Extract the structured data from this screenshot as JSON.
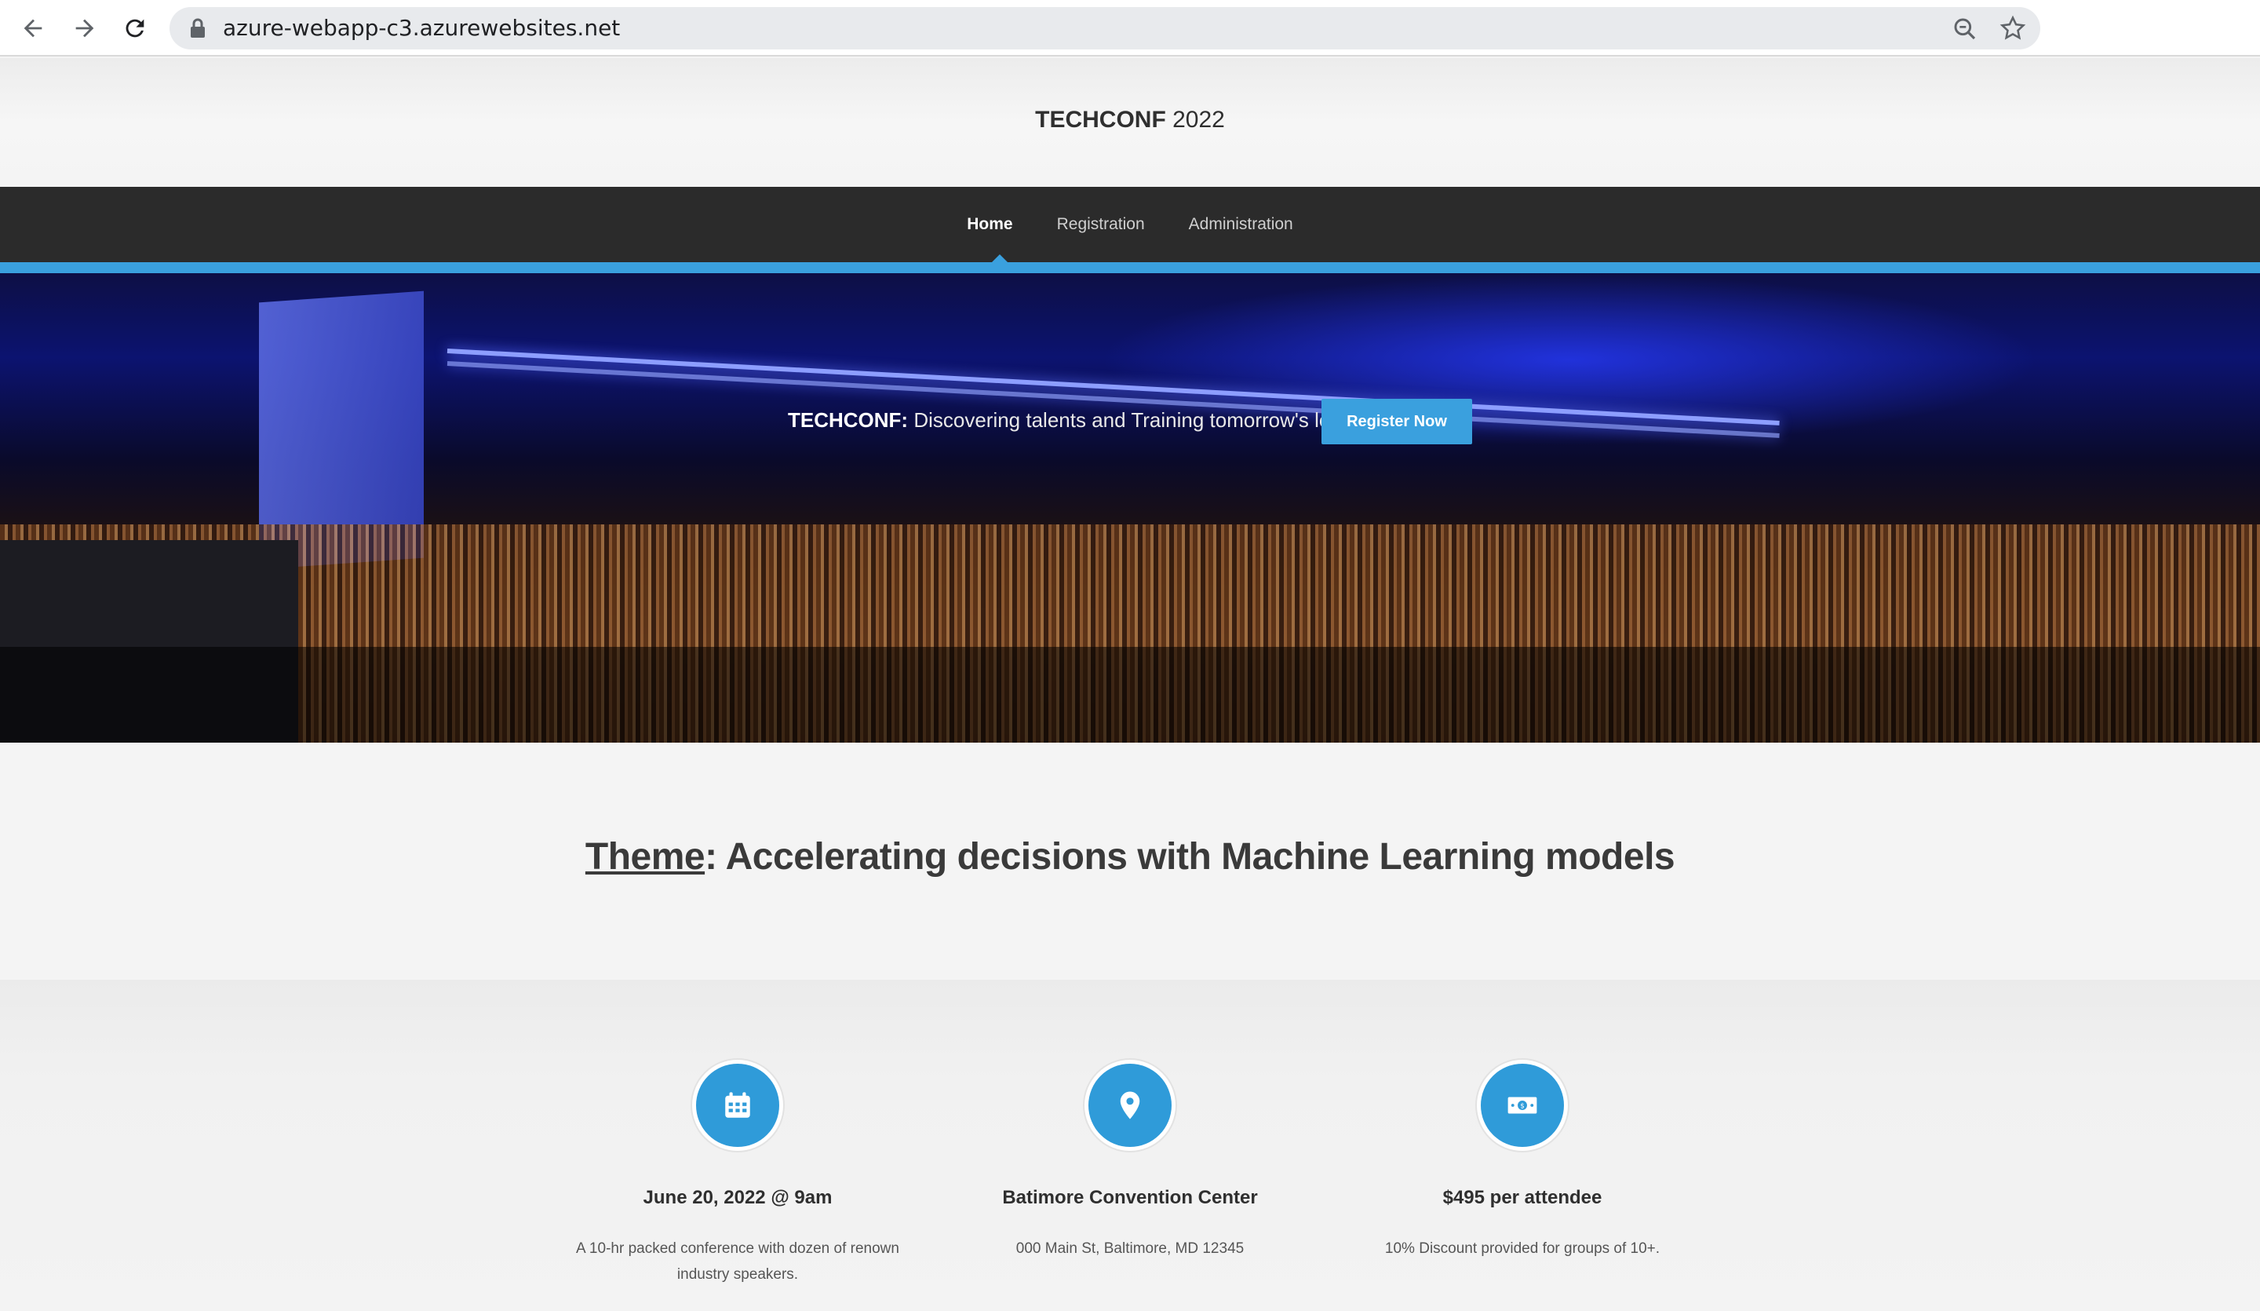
{
  "browser": {
    "url": "azure-webapp-c3.azurewebsites.net",
    "icons": [
      "back-icon",
      "forward-icon",
      "reload-icon",
      "lock-icon",
      "zoom-icon",
      "star-icon"
    ]
  },
  "header": {
    "brand_bold": "TECHCONF",
    "brand_year": " 2022"
  },
  "nav": {
    "items": [
      {
        "label": "Home",
        "active": true
      },
      {
        "label": "Registration",
        "active": false
      },
      {
        "label": "Administration",
        "active": false
      }
    ]
  },
  "banner": {
    "caption_bold": "TECHCONF:",
    "caption_text": " Discovering talents and Training tomorrow's leaders",
    "cta_label": "Register Now"
  },
  "theme": {
    "label": "Theme",
    "text": ": Accelerating decisions with Machine Learning models"
  },
  "features": [
    {
      "icon": "calendar-icon",
      "title": "June 20, 2022 @ 9am",
      "description": "A 10-hr packed conference with dozen of renown industry speakers."
    },
    {
      "icon": "map-pin-icon",
      "title": "Batimore Convention Center",
      "description": "000 Main St, Baltimore, MD 12345"
    },
    {
      "icon": "money-icon",
      "title": "$495 per attendee",
      "description": "10% Discount provided for groups of 10+."
    }
  ],
  "colors": {
    "accent": "#3aa0de",
    "nav_bg": "#2b2b2b",
    "page_bg": "#f4f4f4"
  }
}
